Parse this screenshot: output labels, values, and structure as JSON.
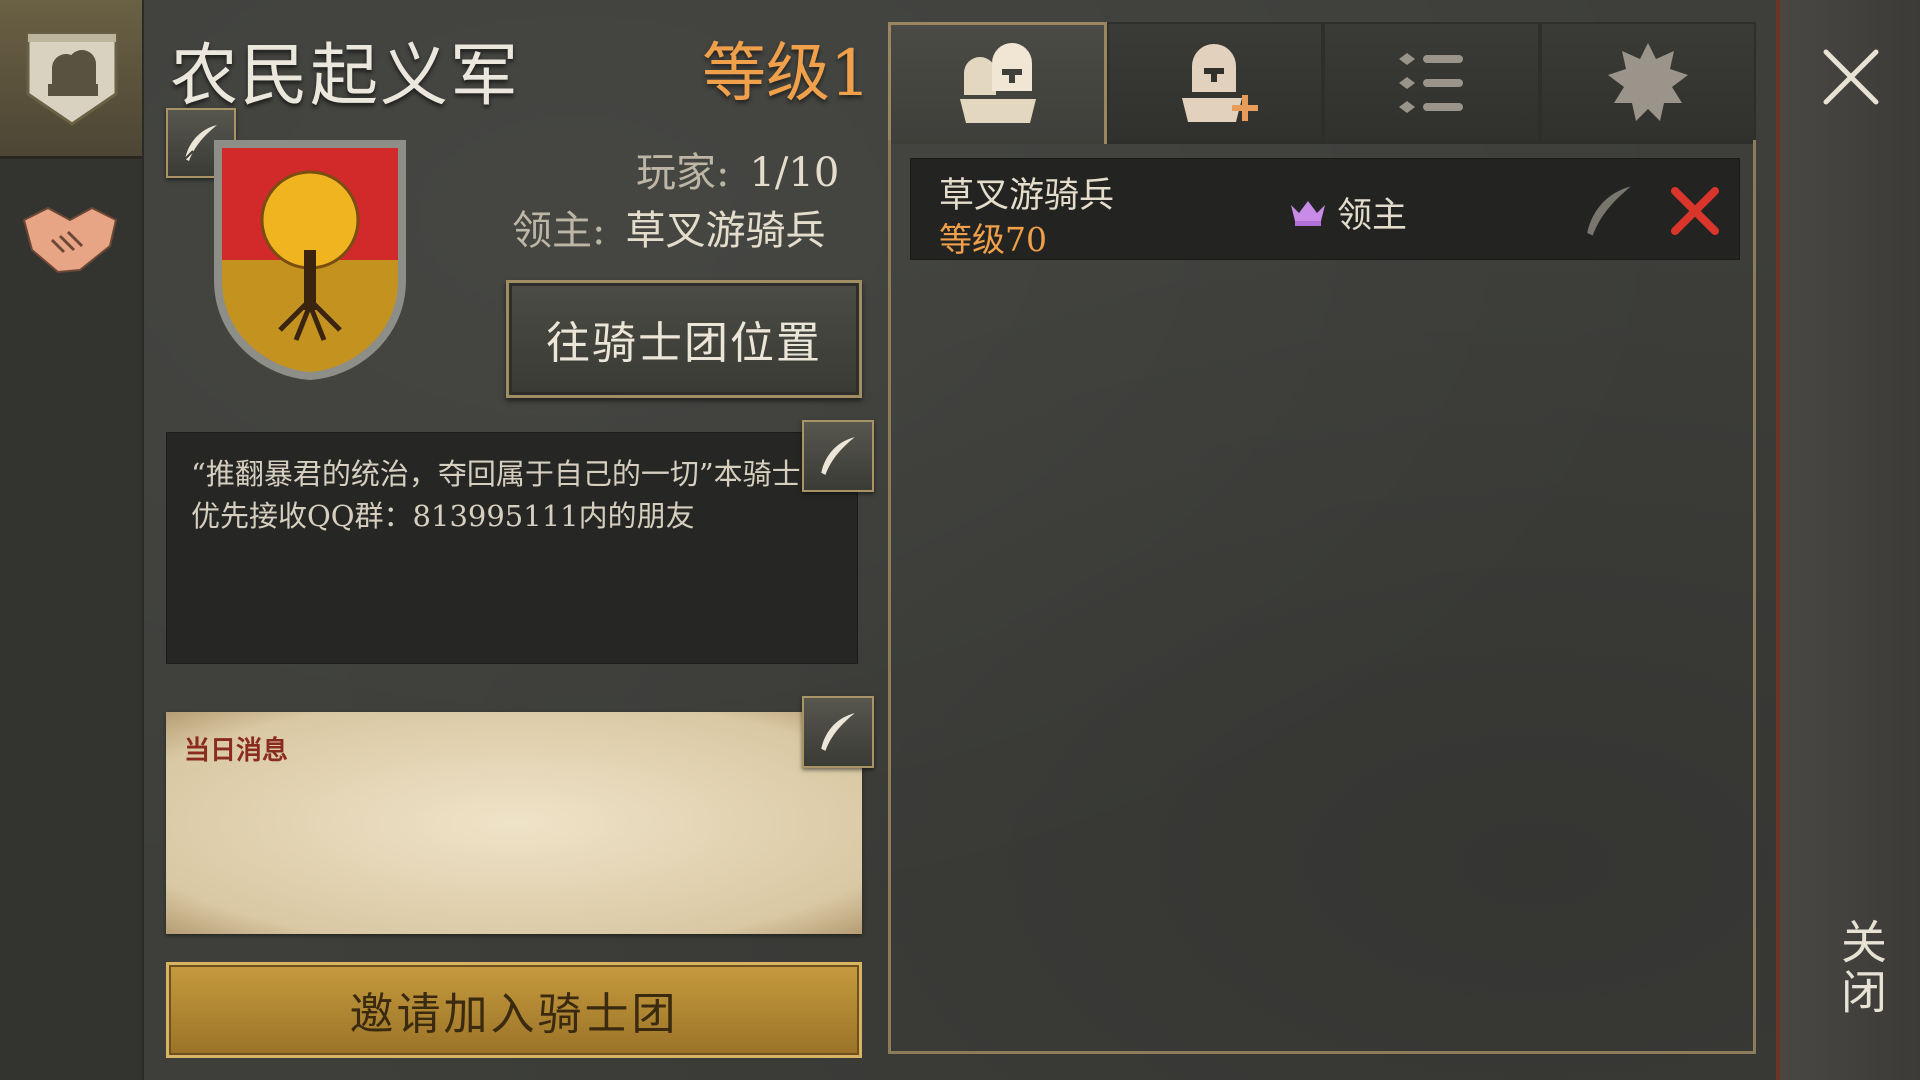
{
  "guild": {
    "name": "农民起义军",
    "level": "等级1",
    "players_label": "玩家:",
    "players_value": "1/10",
    "lord_label": "领主:",
    "lord_value": "草叉游骑兵",
    "goto_button": "往骑士团位置",
    "description": "“推翻暴君的统治，夺回属于自己的一切”本骑士团优先接收QQ群：813995111内的朋友",
    "daily_label": "当日消息",
    "daily_message": "",
    "invite_button": "邀请加入骑士团",
    "crest_colors": {
      "top": "#d22a2a",
      "bottom": "#c4921e",
      "tree": "#f0b420"
    }
  },
  "tabs": [
    {
      "name": "members",
      "icon": "knights-icon",
      "active": true
    },
    {
      "name": "recruit",
      "icon": "add-knight-icon",
      "active": false
    },
    {
      "name": "list",
      "icon": "list-icon",
      "active": false
    },
    {
      "name": "settings",
      "icon": "badge-icon",
      "active": false
    }
  ],
  "members": [
    {
      "name": "草叉游骑兵",
      "level": "等级70",
      "role": "领主"
    }
  ],
  "close": {
    "label": "关闭"
  },
  "colors": {
    "accent_orange": "#f0a04a",
    "kick_red": "#d9352b",
    "crown_purple": "#c98be8"
  }
}
